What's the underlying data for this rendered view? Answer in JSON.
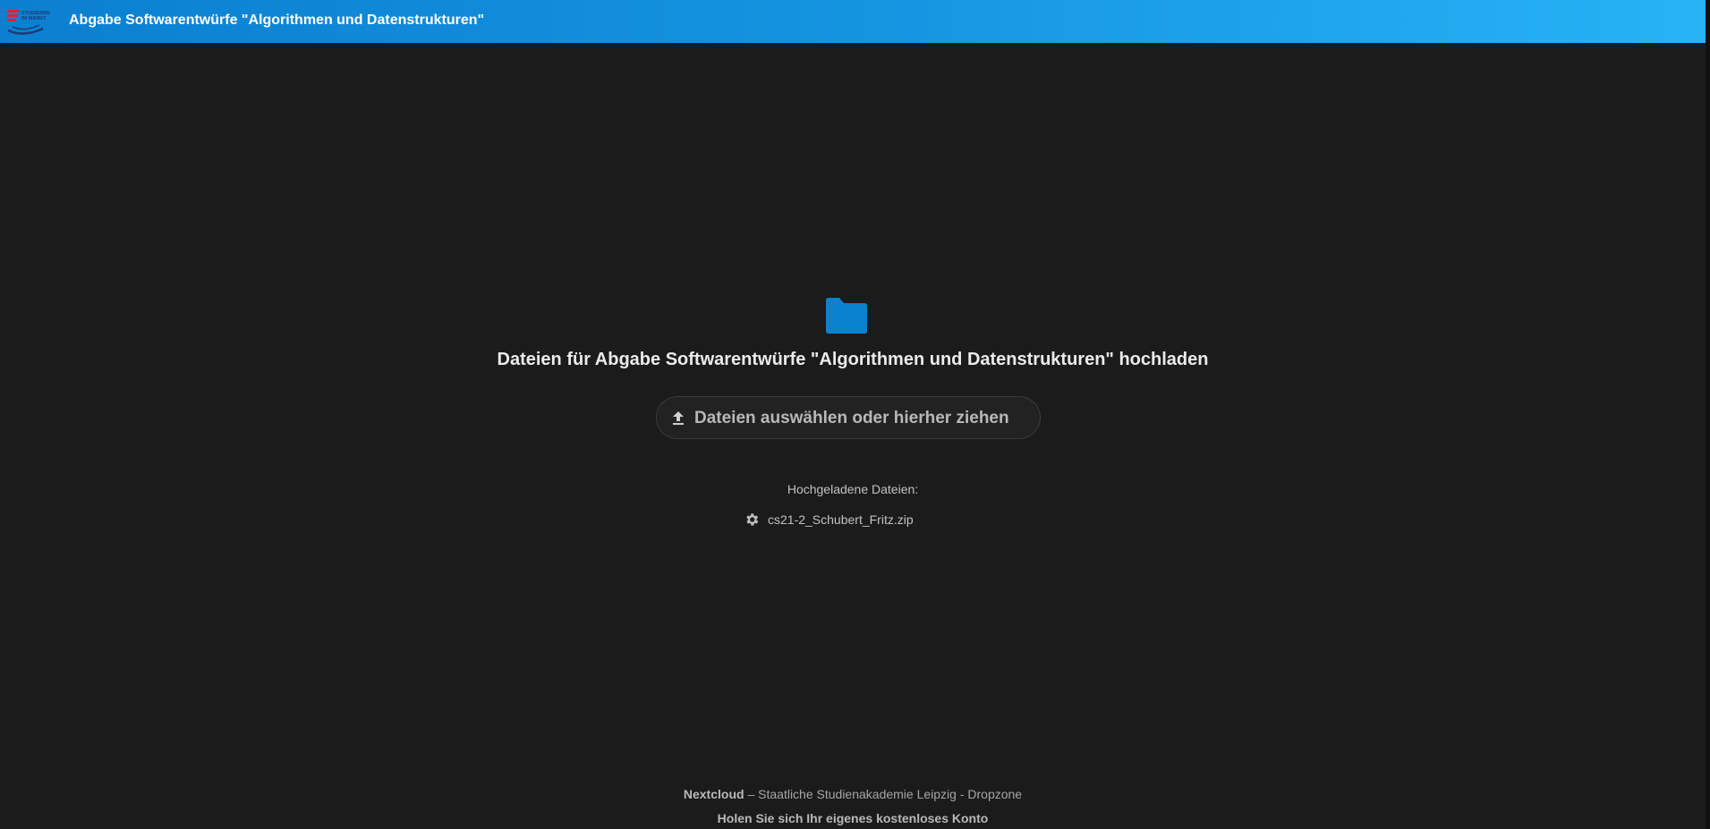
{
  "header": {
    "title": "Abgabe Softwarentwürfe \"Algorithmen und Datenstrukturen\"",
    "logo": {
      "icon": "studieren-im-markt-logo",
      "text_line1": "STUDIEREN",
      "text_line2": "IM MARKT"
    }
  },
  "main": {
    "folder_icon": "folder-icon",
    "heading": "Dateien für Abgabe Softwarentwürfe \"Algorithmen und Datenstrukturen\" hochladen",
    "upload_button": {
      "icon": "upload-icon",
      "label": "Dateien auswählen oder hierher ziehen"
    },
    "uploaded_label": "Hochgeladene Dateien:",
    "files": [
      {
        "icon": "gear-icon",
        "name": "cs21-2_Schubert_Fritz.zip"
      }
    ]
  },
  "footer": {
    "brand": "Nextcloud",
    "separator": " – ",
    "text": "Staatliche Studienakademie Leipzig - Dropzone",
    "signup_link": "Holen Sie sich Ihr eigenes kostenloses Konto"
  },
  "colors": {
    "header_gradient_start": "#0b7fd0",
    "header_gradient_end": "#27b3f6",
    "background": "#1b1b1b",
    "folder": "#0a82d0",
    "logo_red": "#e2203c",
    "logo_navy": "#1d3a78"
  }
}
